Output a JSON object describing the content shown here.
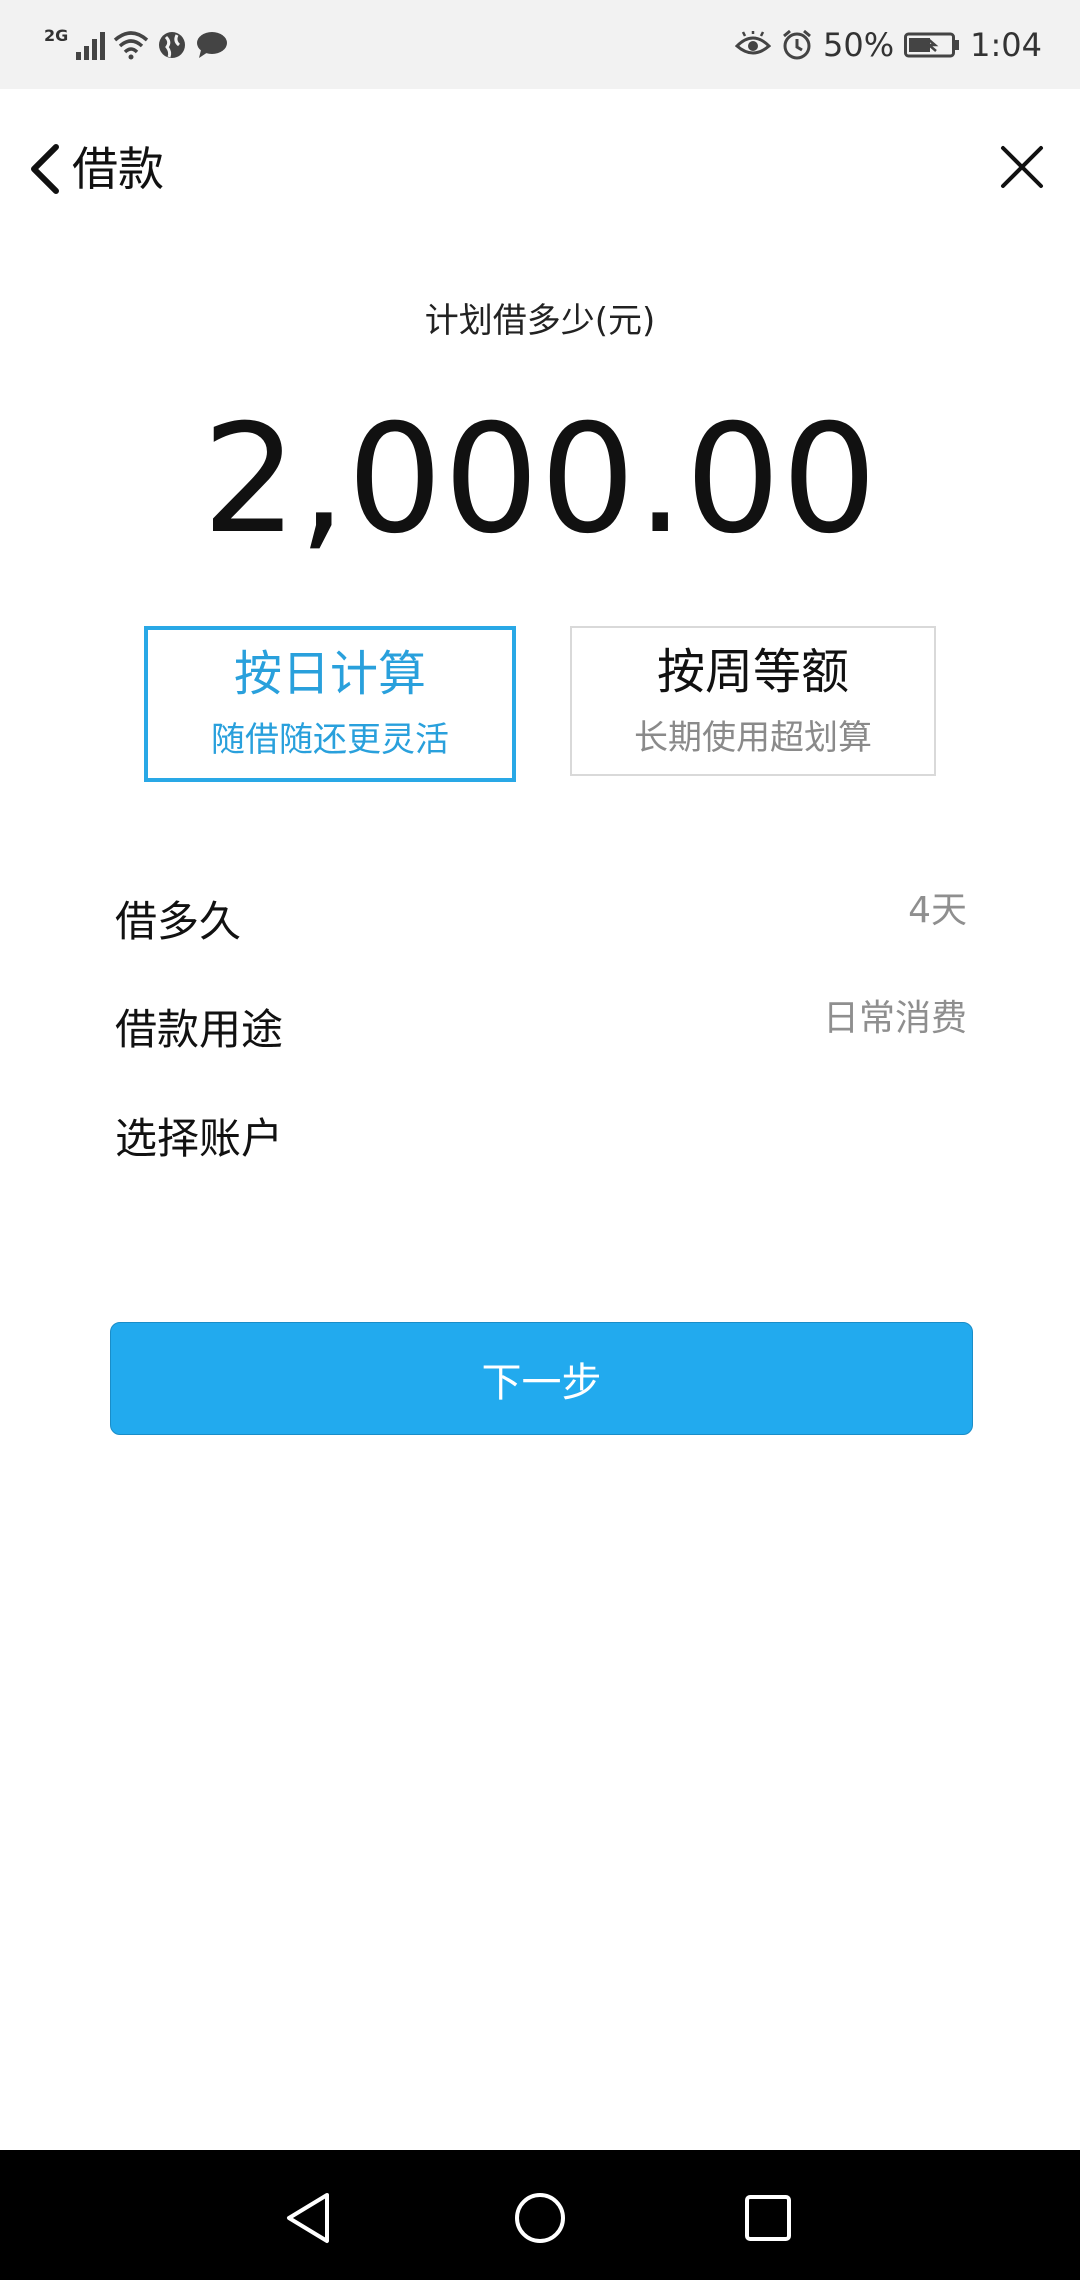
{
  "status_bar": {
    "network_type": "2G",
    "battery": "50%",
    "time": "1:04",
    "icons": [
      "signal-icon",
      "wifi-icon",
      "globe-icon",
      "message-icon",
      "eye-icon",
      "alarm-icon",
      "battery-icon"
    ]
  },
  "header": {
    "title": "借款",
    "back_icon": "chevron-left-icon",
    "close_icon": "close-icon"
  },
  "amount": {
    "label": "计划借多少(元)",
    "value": "2,000.00"
  },
  "plans": [
    {
      "title": "按日计算",
      "subtitle": "随借随还更灵活",
      "selected": true
    },
    {
      "title": "按周等额",
      "subtitle": "长期使用超划算",
      "selected": false
    }
  ],
  "form": {
    "duration_label": "借多久",
    "duration_value": "4天",
    "purpose_label": "借款用途",
    "purpose_value": "日常消费",
    "account_label": "选择账户",
    "account_value": ""
  },
  "next_button": {
    "label": "下一步"
  },
  "colors": {
    "accent": "#22aaee",
    "selected_border": "#29a8e6",
    "muted_text": "#8f8f8f",
    "nav_bar": "#000000"
  }
}
